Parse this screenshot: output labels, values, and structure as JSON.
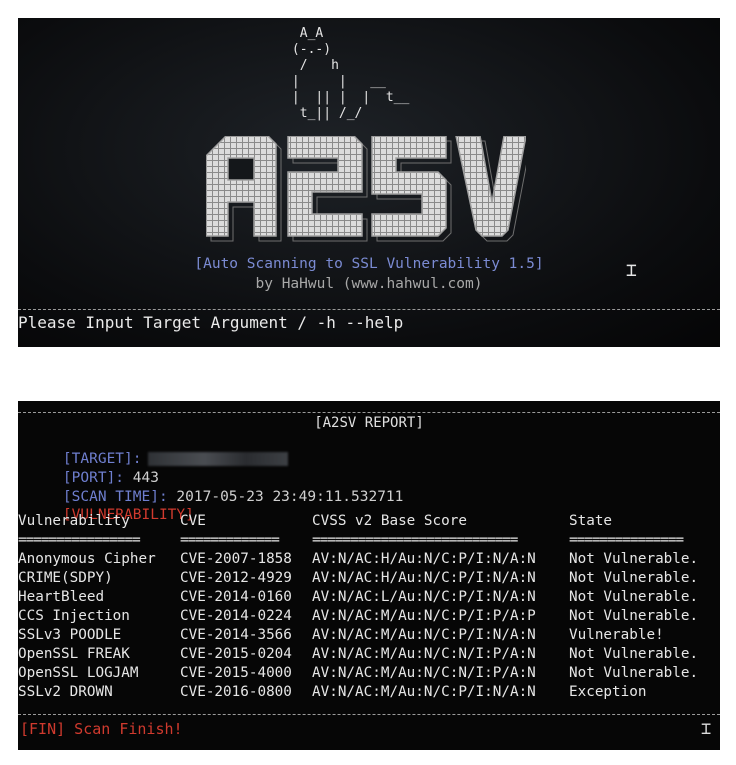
{
  "launch": {
    "ascii_art": "                                    A_A\n                                   (-.-)\n                                    /   h\n                                   |     |   __\n                                   |  || |  |  t__\n                                    t_|| /_/",
    "logo_text": "A2SV",
    "banner_title": "[Auto Scanning to SSL Vulnerability 1.5]",
    "banner_by": "by HaHwul (www.hahwul.com)",
    "prompt": "Please Input Target Argument / -h --help"
  },
  "report": {
    "title": "[A2SV REPORT]",
    "target_label": "[TARGET]:",
    "port_label": "[PORT]:",
    "port_value": "443",
    "scan_time_label": "[SCAN TIME]:",
    "scan_time_value": "2017-05-23 23:49:11.532711",
    "vulnerability_label": "[VULNERABILITY]",
    "columns": [
      "Vulnerability",
      "CVE",
      "CVSS v2 Base Score",
      "State"
    ],
    "separators": [
      "================",
      "=============",
      "===========================",
      "==============="
    ],
    "rows": [
      {
        "name": "Anonymous Cipher",
        "cve": "CVE-2007-1858",
        "cvss": "AV:N/AC:H/Au:N/C:P/I:N/A:N",
        "state": "Not Vulnerable."
      },
      {
        "name": "CRIME(SDPY)",
        "cve": "CVE-2012-4929",
        "cvss": "AV:N/AC:H/Au:N/C:P/I:N/A:N",
        "state": "Not Vulnerable."
      },
      {
        "name": "HeartBleed",
        "cve": "CVE-2014-0160",
        "cvss": "AV:N/AC:L/Au:N/C:P/I:N/A:N",
        "state": "Not Vulnerable."
      },
      {
        "name": "CCS Injection",
        "cve": "CVE-2014-0224",
        "cvss": "AV:N/AC:M/Au:N/C:P/I:P/A:P",
        "state": "Not Vulnerable."
      },
      {
        "name": "SSLv3 POODLE",
        "cve": "CVE-2014-3566",
        "cvss": "AV:N/AC:M/Au:N/C:P/I:N/A:N",
        "state": "Vulnerable!"
      },
      {
        "name": "OpenSSL FREAK",
        "cve": "CVE-2015-0204",
        "cvss": "AV:N/AC:M/Au:N/C:N/I:P/A:N",
        "state": "Not Vulnerable."
      },
      {
        "name": "OpenSSL LOGJAM",
        "cve": "CVE-2015-4000",
        "cvss": "AV:N/AC:M/Au:N/C:N/I:P/A:N",
        "state": "Not Vulnerable."
      },
      {
        "name": "SSLv2 DROWN",
        "cve": "CVE-2016-0800",
        "cvss": "AV:N/AC:M/Au:N/C:P/I:N/A:N",
        "state": "Exception"
      }
    ],
    "fin_text": "[FIN] Scan Finish!"
  },
  "colors": {
    "label_blue": "#6f7fcf",
    "alert_red": "#d03a2e",
    "terminal_bg": "#0b0c0e"
  },
  "icons": {
    "cursor": "i-beam-cursor-icon"
  }
}
